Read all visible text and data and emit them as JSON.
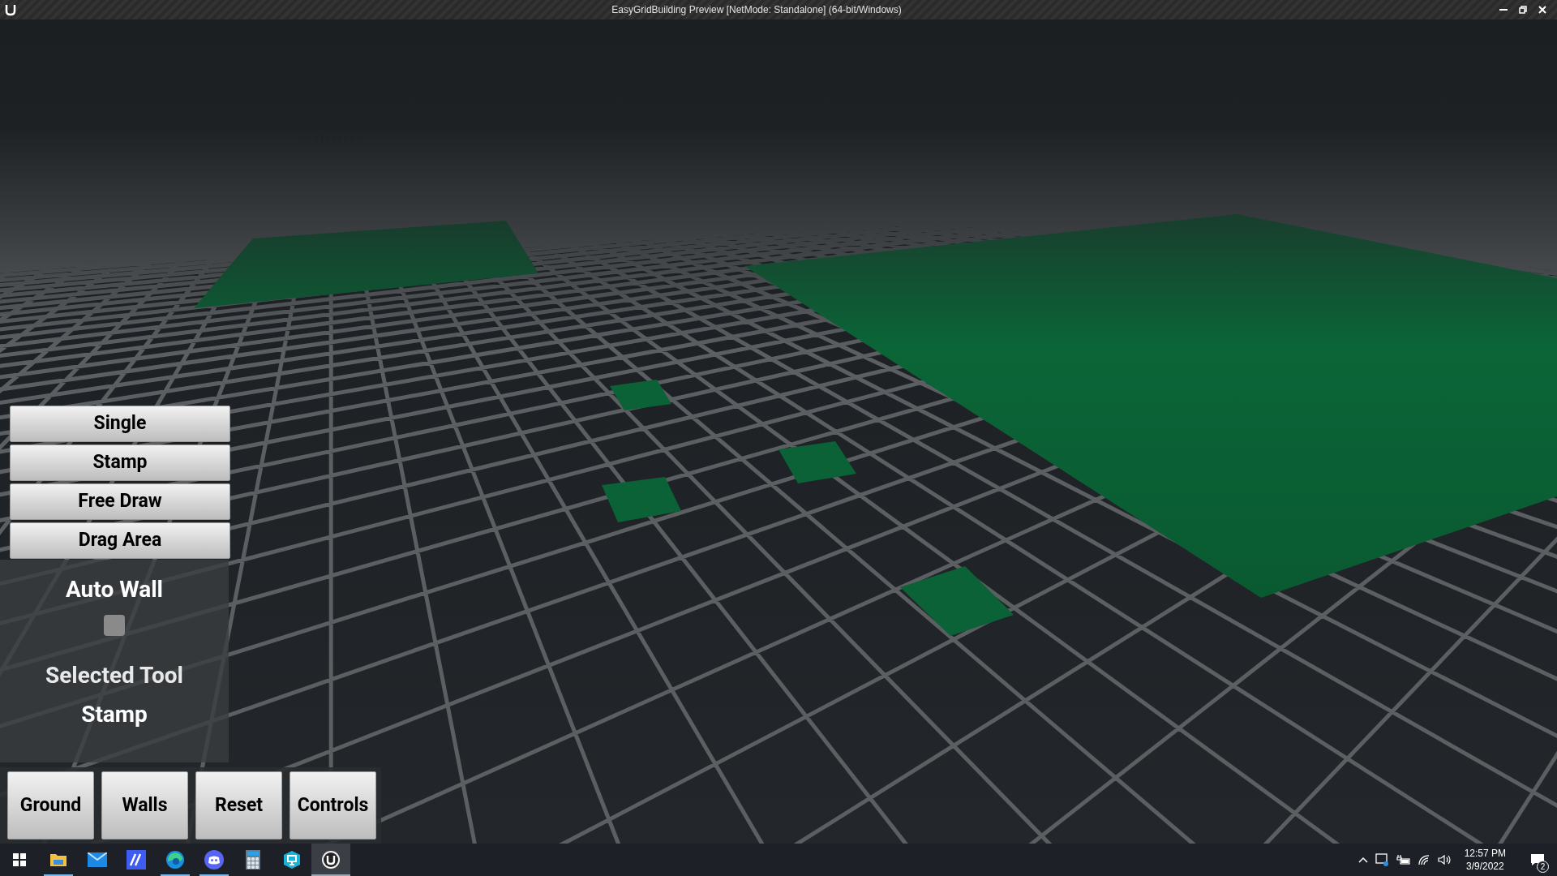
{
  "window": {
    "title": "EasyGridBuilding Preview [NetMode: Standalone] (64-bit/Windows)"
  },
  "tool_buttons": [
    "Single",
    "Stamp",
    "Free Draw",
    "Drag Area"
  ],
  "auto_wall": {
    "label": "Auto Wall",
    "checked": false
  },
  "selected_tool": {
    "label": "Selected Tool",
    "value": "Stamp"
  },
  "bottom_buttons": [
    "Ground",
    "Walls",
    "Reset",
    "Controls"
  ],
  "taskbar": {
    "apps": [
      {
        "kind": "explorer",
        "running": true,
        "selected": false
      },
      {
        "kind": "mail",
        "running": false,
        "selected": false
      },
      {
        "kind": "design",
        "running": false,
        "selected": false
      },
      {
        "kind": "browser",
        "running": true,
        "selected": false
      },
      {
        "kind": "chat",
        "running": true,
        "selected": false
      },
      {
        "kind": "calculator",
        "running": false,
        "selected": false
      },
      {
        "kind": "remote",
        "running": false,
        "selected": false
      },
      {
        "kind": "engine",
        "running": true,
        "selected": true
      }
    ],
    "time": "12:57 PM",
    "date": "3/9/2022",
    "notifications": "2"
  }
}
